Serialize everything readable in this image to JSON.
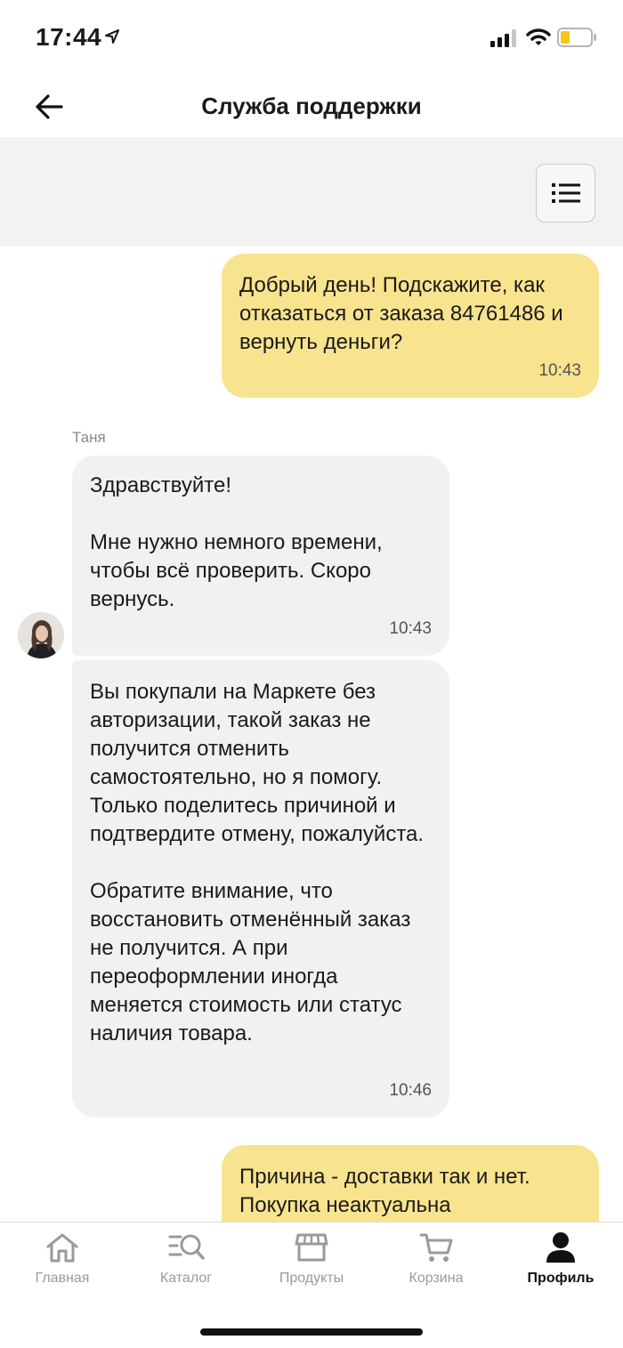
{
  "status_bar": {
    "time": "17:44"
  },
  "header": {
    "title": "Служба поддержки"
  },
  "chat": {
    "messages": [
      {
        "text": "Добрый день! Подскажите, как отказаться от заказа 84761486 и вернуть деньги?",
        "time": "10:43"
      },
      {
        "author": "Таня",
        "text": "Здравствуйте!\n\nМне нужно немного времени, чтобы всё проверить. Скоро вернусь.",
        "time": "10:43"
      },
      {
        "text": "Вы покупали на Маркете без авторизации, такой заказ не получится отменить самостоятельно, но я помогу. Только поделитесь причиной и подтвердите отмену, пожалуйста.\n\nОбратите внимание, что восстановить отменённый заказ не получится. А при переоформлении иногда меняется стоимость или статус наличия товара.",
        "time": "10:46"
      },
      {
        "text": "Причина - доставки так и нет. Покупка неактуальна"
      }
    ]
  },
  "tabbar": {
    "items": [
      {
        "label": "Главная",
        "icon": "home-icon"
      },
      {
        "label": "Каталог",
        "icon": "catalog-search-icon"
      },
      {
        "label": "Продукты",
        "icon": "store-icon"
      },
      {
        "label": "Корзина",
        "icon": "cart-icon"
      },
      {
        "label": "Профиль",
        "icon": "profile-icon",
        "active": true
      }
    ]
  },
  "colors": {
    "outgoing_bubble": "#f8e38e",
    "incoming_bubble": "#f1f1f1",
    "toolbar_bg": "#f2f2f2",
    "battery_fill": "#f5c518"
  }
}
